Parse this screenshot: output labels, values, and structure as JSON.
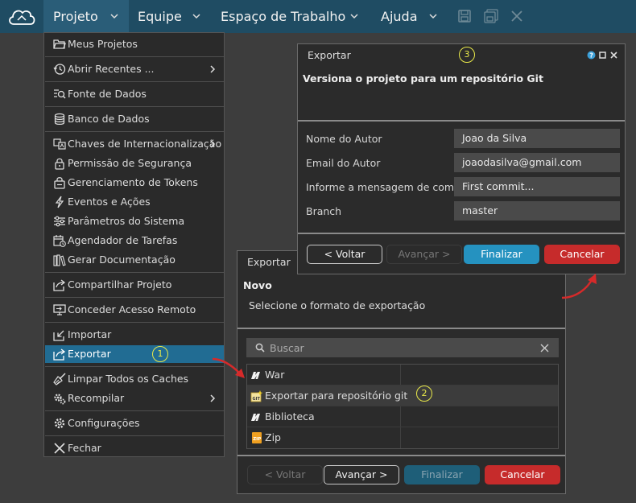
{
  "menubar": {
    "items": [
      "Projeto",
      "Equipe",
      "Espaço de Trabalho",
      "Ajuda"
    ]
  },
  "project_menu": {
    "items": [
      "Meus Projetos",
      "Abrir Recentes ...",
      "Fonte de Dados",
      "Banco de Dados",
      "Chaves de Internacionalização",
      "Permissão de Segurança",
      "Gerenciamento de Tokens",
      "Eventos e Ações",
      "Parâmetros do Sistema",
      "Agendador de Tarefas",
      "Gerar Documentação",
      "Compartilhar Projeto",
      "Conceder Acesso Remoto",
      "Importar",
      "Exportar",
      "Limpar Todos os Caches",
      "Recompilar",
      "Configurações",
      "Fechar"
    ],
    "selected": "Exportar"
  },
  "markers": [
    "1",
    "2",
    "3"
  ],
  "export_dialog": {
    "title": "Exportar",
    "heading": "Novo",
    "subtitle": "Selecione o formato de exportação",
    "search_placeholder": "Buscar",
    "options": [
      "War",
      "Exportar para repositório git",
      "Biblioteca",
      "Zip"
    ],
    "buttons": {
      "back": "< Voltar",
      "next": "Avançar >",
      "finish": "Finalizar",
      "cancel": "Cancelar"
    }
  },
  "git_dialog": {
    "title": "Exportar",
    "heading": "Versiona o projeto para um repositório Git",
    "fields": [
      {
        "label": "Nome do Autor",
        "value": "Joao da Silva"
      },
      {
        "label": "Email do Autor",
        "value": "joaodasilva@gmail.com"
      },
      {
        "label": "Informe a mensagem de commit",
        "value": "First commit..."
      },
      {
        "label": "Branch",
        "value": "master"
      }
    ],
    "buttons": {
      "back": "< Voltar",
      "next": "Avançar >",
      "finish": "Finalizar",
      "cancel": "Cancelar"
    }
  },
  "colors": {
    "menubar": "#1f4c63",
    "selected": "#216c93",
    "blue_button": "#2592c0",
    "red_button": "#c62b2b",
    "marker": "#e8e84a",
    "arrow": "#d62a2a"
  }
}
